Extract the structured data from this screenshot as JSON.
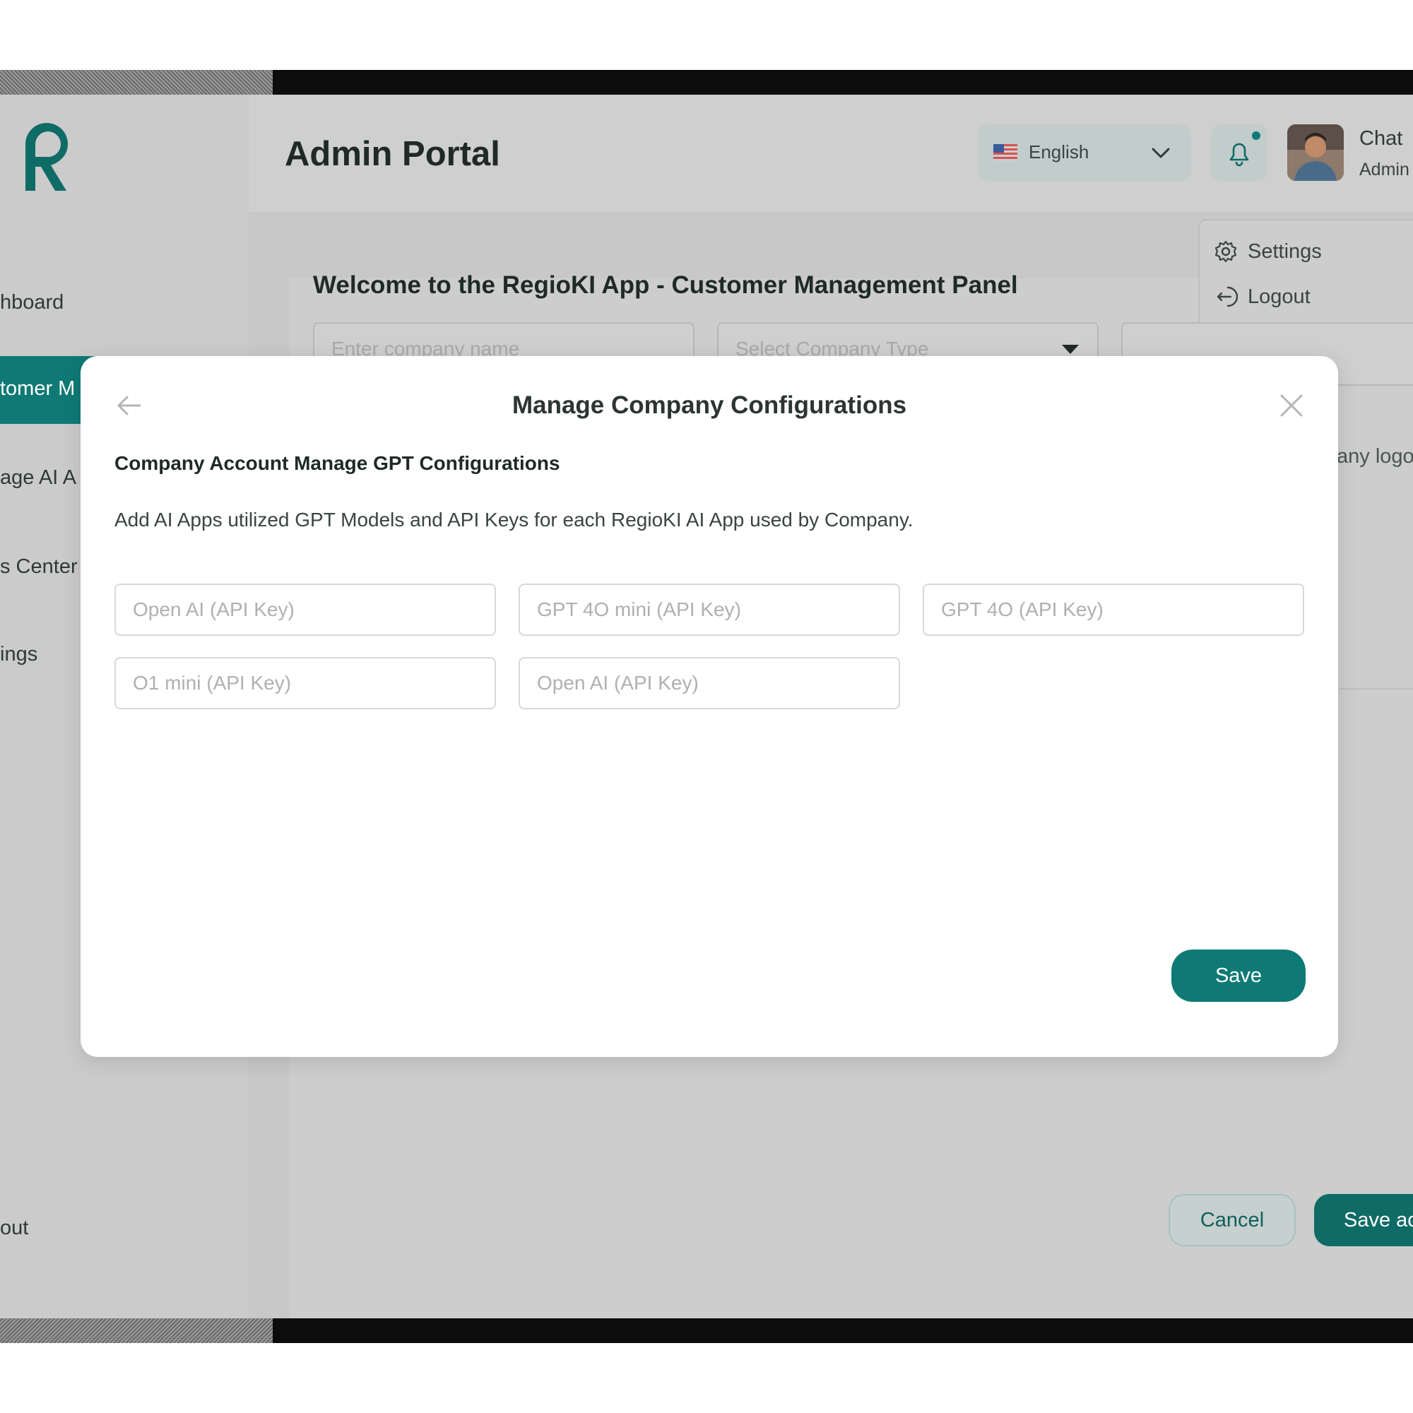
{
  "header": {
    "title": "Admin Portal",
    "language": "English",
    "user_name": "Chat",
    "user_role": "Admin"
  },
  "sidebar": {
    "items": [
      {
        "label": "hboard"
      },
      {
        "label": "tomer M"
      },
      {
        "label": "age AI A"
      },
      {
        "label": "s Center"
      },
      {
        "label": "ings"
      },
      {
        "label": "out"
      }
    ]
  },
  "user_menu": {
    "settings": "Settings",
    "logout": "Logout"
  },
  "background": {
    "welcome": "Welcome to the RegioKI App - Customer Management Panel",
    "company_name_placeholder": "Enter company name",
    "company_type_placeholder": "Select Company Type",
    "right_text": "any logo",
    "cancel": "Cancel",
    "save_all": "Save ac"
  },
  "modal": {
    "title": "Manage Company Configurations",
    "subtitle": "Company Account Manage GPT Configurations",
    "description": "Add AI Apps utilized GPT Models and API Keys for each RegioKI AI App used by Company.",
    "fields": [
      {
        "placeholder": "Open AI (API Key)",
        "value": ""
      },
      {
        "placeholder": "GPT 4O mini (API Key)",
        "value": ""
      },
      {
        "placeholder": "GPT 4O (API Key)",
        "value": ""
      },
      {
        "placeholder": "O1 mini (API Key)",
        "value": ""
      },
      {
        "placeholder": "Open AI (API Key)",
        "value": ""
      }
    ],
    "save": "Save"
  },
  "colors": {
    "accent": "#0f7a75",
    "overlay_background": "#cfcfcf",
    "modal_background": "#ffffff"
  },
  "icons": [
    "logo-icon",
    "us-flag-icon",
    "chevron-down-icon",
    "bell-icon",
    "gear-icon",
    "logout-icon",
    "arrow-left-icon",
    "close-icon"
  ]
}
